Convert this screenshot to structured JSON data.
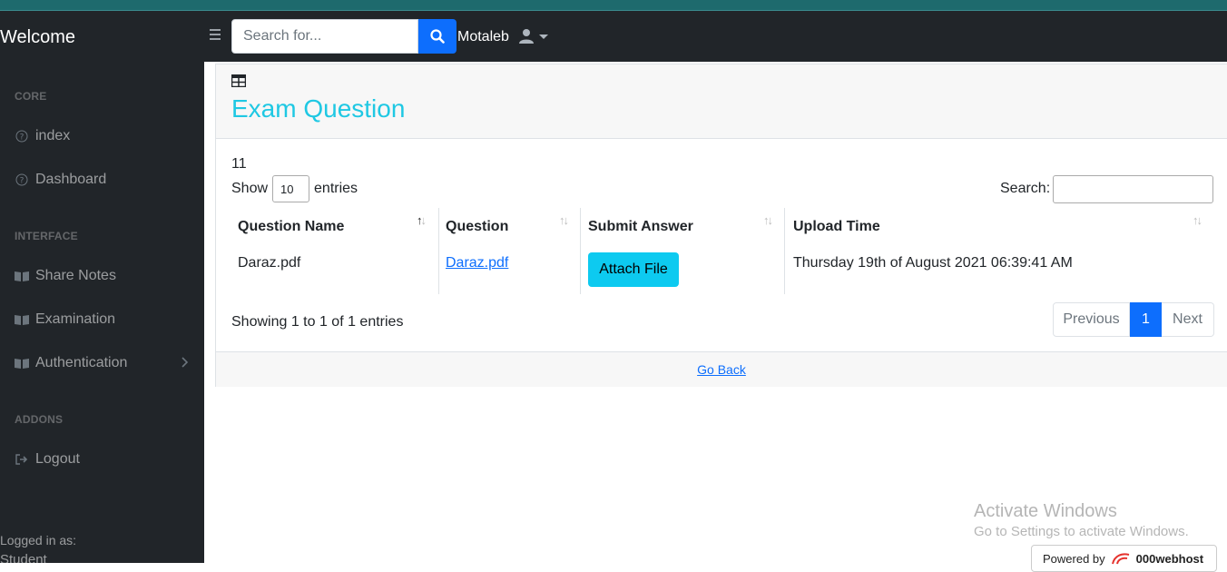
{
  "navbar": {
    "brand": "Welcome",
    "search_placeholder": "Search for...",
    "user_name": "Motaleb"
  },
  "sidebar": {
    "headings": {
      "core": "CORE",
      "interface": "INTERFACE",
      "addons": "ADDONS"
    },
    "items": [
      {
        "label": "index",
        "icon": "question-circle-icon"
      },
      {
        "label": "Dashboard",
        "icon": "question-circle-icon"
      },
      {
        "label": "Share Notes",
        "icon": "book-icon"
      },
      {
        "label": "Examination",
        "icon": "book-icon"
      },
      {
        "label": "Authentication",
        "icon": "book-icon"
      },
      {
        "label": "Logout",
        "icon": "sign-out-icon"
      }
    ],
    "footer_label": "Logged in as:",
    "footer_user": "Student"
  },
  "card": {
    "title": "Exam Question",
    "count": "11",
    "show_label": "Show",
    "entries_value": "10",
    "entries_label": "entries",
    "search_label": "Search:",
    "columns": [
      "Question Name",
      "Question",
      "Submit Answer",
      "Upload Time"
    ],
    "rows": [
      {
        "question_name": "Daraz.pdf",
        "question_link": "Daraz.pdf",
        "action": "Attach File",
        "upload_time": "Thursday 19th of August 2021 06:39:41 AM"
      }
    ],
    "info": "Showing 1 to 1 of 1 entries",
    "pagination": {
      "previous": "Previous",
      "current": "1",
      "next": "Next"
    },
    "footer_link": "Go Back"
  },
  "watermark": {
    "line1": "Activate Windows",
    "line2": "Go to Settings to activate Windows.",
    "powered_by": "Powered by",
    "host": "000webhost"
  },
  "colors": {
    "accent": "#0d6efd",
    "title": "#1fc8e3",
    "attach_button": "#0dcaf0",
    "dark": "#212529"
  }
}
